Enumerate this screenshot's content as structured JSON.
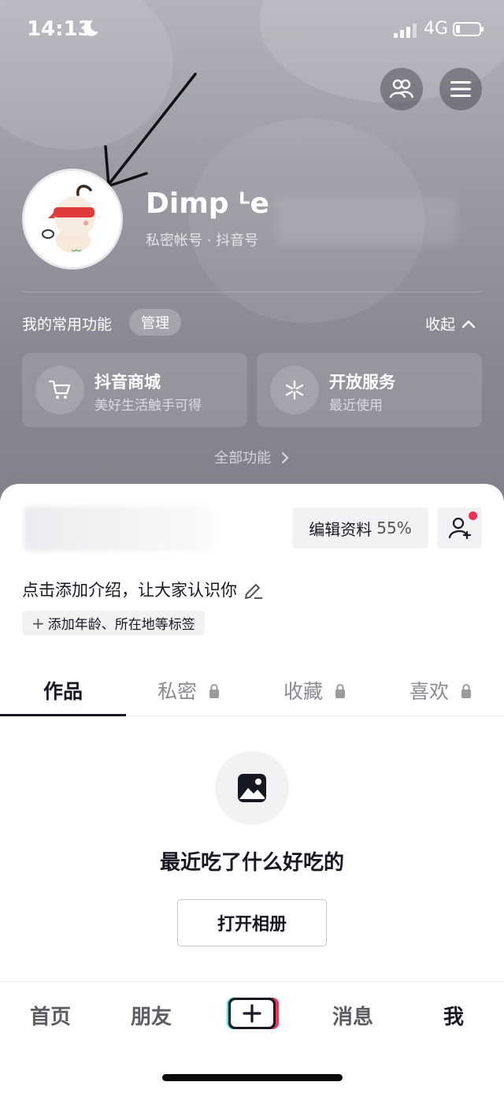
{
  "status": {
    "time": "14:13",
    "network": "4G"
  },
  "profile": {
    "name": "Dimp ᴸe",
    "sub": "私密帐号 · 抖音号"
  },
  "functions": {
    "title": "我的常用功能",
    "manage": "管理",
    "collapse": "收起",
    "cards": [
      {
        "title": "抖音商城",
        "subtitle": "美好生活触手可得",
        "icon": "cart-icon"
      },
      {
        "title": "开放服务",
        "subtitle": "最近使用",
        "icon": "service-icon"
      }
    ],
    "all": "全部功能"
  },
  "edit": {
    "label": "编辑资料",
    "percent": "55%"
  },
  "bio": {
    "placeholder": "点击添加介绍，让大家认识你",
    "tag": "添加年龄、所在地等标签"
  },
  "tabs": [
    {
      "label": "作品",
      "locked": false
    },
    {
      "label": "私密",
      "locked": true
    },
    {
      "label": "收藏",
      "locked": true
    },
    {
      "label": "喜欢",
      "locked": true
    }
  ],
  "empty": {
    "text": "最近吃了什么好吃的",
    "button": "打开相册"
  },
  "nav": {
    "home": "首页",
    "friends": "朋友",
    "messages": "消息",
    "me": "我"
  },
  "colors": {
    "accent": "#fe2c55",
    "cyan": "#25f4ee",
    "text": "#161823"
  }
}
